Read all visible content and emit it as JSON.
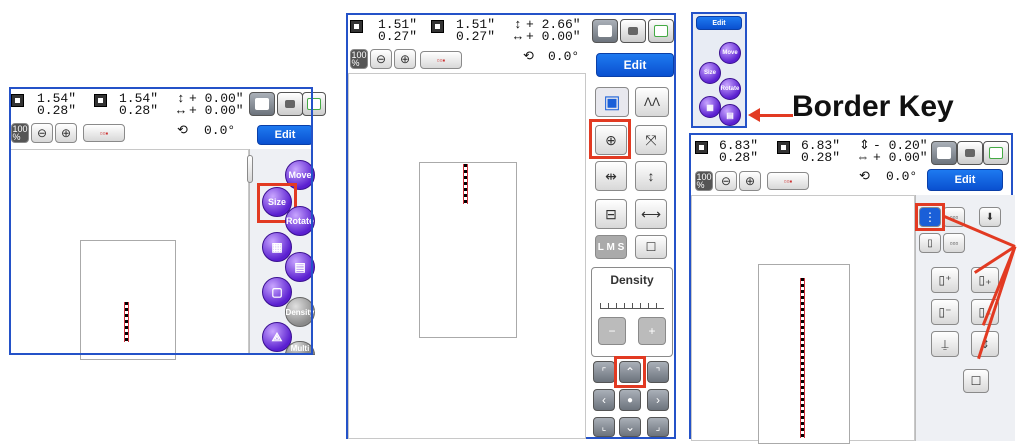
{
  "panel1": {
    "width1": "1.54\"",
    "height1": "0.28\"",
    "width2": "1.54\"",
    "height2": "0.28\"",
    "offset_v": "+ 0.00\"",
    "offset_h": "+ 0.00\"",
    "rotation": "0.0°",
    "zoom": "100\n%",
    "edit_label": "Edit",
    "orbs": {
      "move": "Move",
      "size": "Size",
      "rotate": "Rotate",
      "density": "Density",
      "multi": "Multi"
    }
  },
  "panel2": {
    "width1": "1.51\"",
    "height1": "0.27\"",
    "width2": "1.51\"",
    "height2": "0.27\"",
    "offset_v": "+ 2.66\"",
    "offset_h": "+ 0.00\"",
    "rotation": "0.0°",
    "zoom": "100\n%",
    "edit_label": "Edit",
    "lms_label": "L M S",
    "density_label": "Density"
  },
  "panel3": {
    "title": "Edit",
    "orbs": {
      "move": "Move",
      "size": "Size",
      "rotate": "Rotate"
    }
  },
  "border_key_label": "Border Key",
  "panel4": {
    "width1": "6.83\"",
    "height1": "0.28\"",
    "width2": "6.83\"",
    "height2": "0.28\"",
    "offset_v": "- 0.20\"",
    "offset_h": "+ 0.00\"",
    "rotation": "0.0°",
    "zoom": "100\n%",
    "edit_label": "Edit"
  },
  "colors": {
    "accent_blue": "#0a50d0",
    "highlight_red": "#e23a22",
    "orb_purple": "#5a1fd0",
    "frame_blue": "#2452c8"
  }
}
